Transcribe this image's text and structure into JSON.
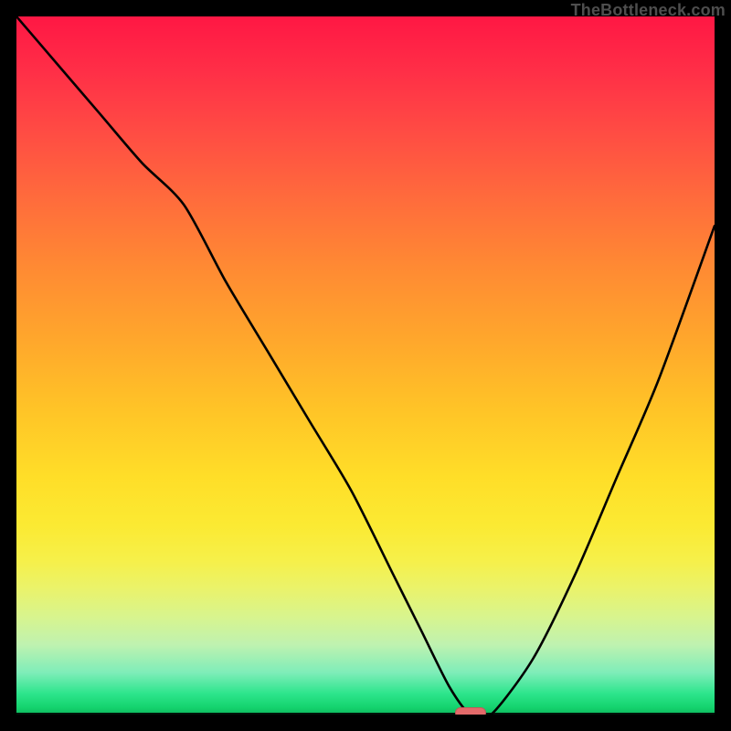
{
  "watermark": {
    "text": "TheBottleneck.com"
  },
  "chart_data": {
    "type": "line",
    "title": "",
    "xlabel": "",
    "ylabel": "",
    "xlim": [
      0,
      100
    ],
    "ylim": [
      0,
      100
    ],
    "background": "rainbow-gradient (red top → green bottom)",
    "marker": {
      "x": 65,
      "y": 0,
      "shape": "pill",
      "color": "#e36a6a"
    },
    "series": [
      {
        "name": "curve",
        "color": "#000000",
        "x": [
          0,
          6,
          12,
          18,
          24,
          30,
          36,
          42,
          48,
          54,
          58,
          62,
          65,
          68,
          74,
          80,
          86,
          92,
          100
        ],
        "values": [
          100,
          93,
          86,
          79,
          73,
          62,
          52,
          42,
          32,
          20,
          12,
          4,
          0,
          0,
          8,
          20,
          34,
          48,
          70
        ]
      }
    ]
  }
}
